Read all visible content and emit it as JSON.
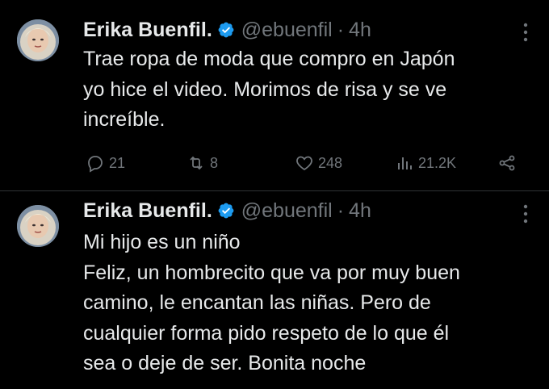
{
  "tweets": [
    {
      "author_name": "Erika Buenfil.",
      "handle": "@ebuenfil",
      "separator": "·",
      "time": "4h",
      "text": "Trae ropa de moda que compro en Japón\nyo hice el video. Morimos de risa y se ve\nincreíble.",
      "actions": {
        "replies": "21",
        "retweets": "8",
        "likes": "248",
        "views": "21.2K"
      }
    },
    {
      "author_name": "Erika Buenfil.",
      "handle": "@ebuenfil",
      "separator": "·",
      "time": "4h",
      "text": "Mi hijo es un niño\nFeliz, un hombrecito que va por muy buen\ncamino, le encantan las niñas. Pero de\ncualquier forma pido respeto de lo que él\nsea o deje de ser.  Bonita noche"
    }
  ],
  "colors": {
    "background": "#000000",
    "text": "#e7e9ea",
    "muted": "#71767b",
    "verified": "#1d9bf0",
    "divider": "#2f3336"
  },
  "icons": [
    "verified-badge-icon",
    "more-options-icon",
    "reply-icon",
    "retweet-icon",
    "like-icon",
    "views-icon",
    "share-icon"
  ]
}
